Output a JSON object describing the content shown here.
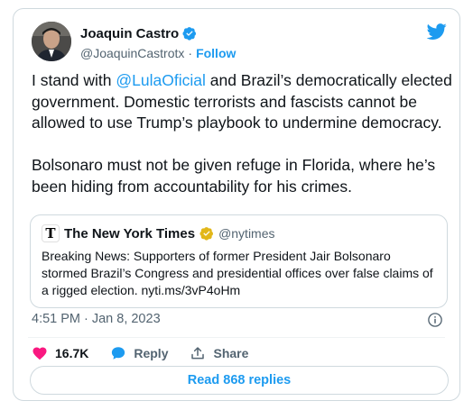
{
  "author": {
    "name": "Joaquin Castro",
    "handle": "@JoaquinCastrotx",
    "separator": "·",
    "follow_label": "Follow"
  },
  "tweet": {
    "p1_before": "I stand with ",
    "p1_mention": "@LulaOficial",
    "p1_after": " and Brazil’s democratically elected government. Domestic terrorists and fascists cannot be allowed to use Trump’s playbook to undermine democracy.",
    "p2": "Bolsonaro must not be given refuge in Florida, where he’s been hiding from accountability for his crimes."
  },
  "quote": {
    "name": "The New York Times",
    "handle": "@nytimes",
    "logo_letter": "T",
    "body": "Breaking News: Supporters of former President Jair Bolsonaro stormed Brazil’s Congress and presidential offices over false claims of a rigged election. nyti.ms/3vP4oHm"
  },
  "meta": {
    "time": "4:51 PM",
    "separator": "·",
    "date": "Jan 8, 2023"
  },
  "actions": {
    "like_count": "16.7K",
    "reply_label": "Reply",
    "share_label": "Share"
  },
  "replies_button": "Read 868 replies",
  "colors": {
    "accent": "#1d9bf0",
    "like": "#f91880",
    "text": "#0f1419",
    "secondary": "#536471",
    "border": "#cfd9de"
  }
}
